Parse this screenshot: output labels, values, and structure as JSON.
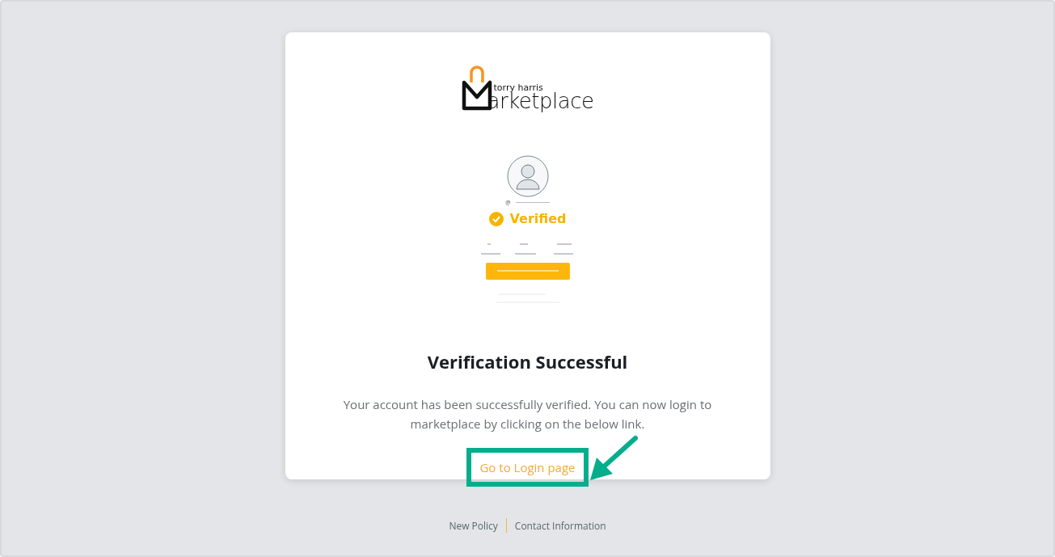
{
  "logo": {
    "tagline": "torry harris",
    "wordmark": "arketplace"
  },
  "illustration": {
    "handle": "@",
    "badge": "Verified"
  },
  "title": "Verification Successful",
  "message": "Your account has been successfully verified. You can now login to marketplace by clicking on the below link.",
  "link": {
    "label": "Go to Login page",
    "highlighted": true
  },
  "footer": [
    "New Policy",
    "Contact Information"
  ]
}
